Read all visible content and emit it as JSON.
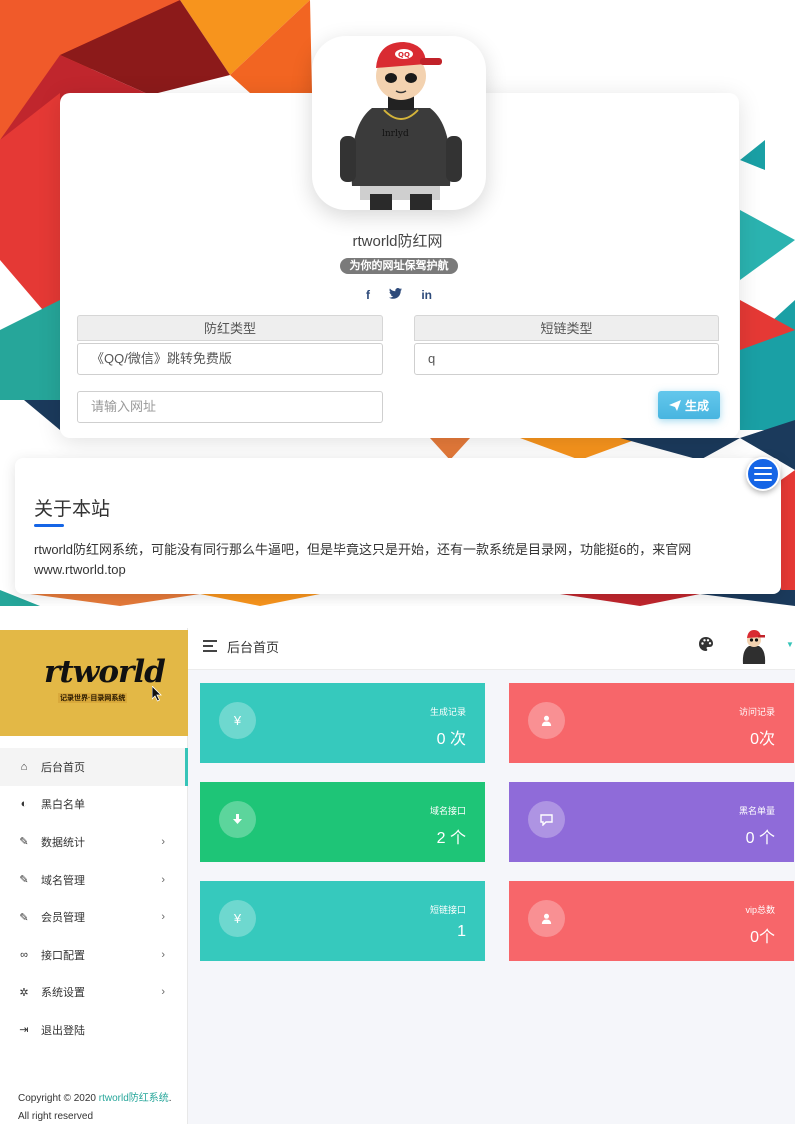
{
  "landing": {
    "site_name": "rtworld防红网",
    "slogan": "为你的网址保驾护航",
    "socials": [
      {
        "name": "facebook-icon",
        "glyph": "f"
      },
      {
        "name": "twitter-icon",
        "glyph": "🐦"
      },
      {
        "name": "linkedin-icon",
        "glyph": "in"
      }
    ],
    "form": {
      "type_label": "防红类型",
      "type_value": "《QQ/微信》跳转免费版",
      "short_label": "短链类型",
      "short_value": "q",
      "url_placeholder": "请输入网址",
      "generate_label": "生成"
    },
    "about": {
      "title": "关于本站",
      "text": "rtworld防红网系统，可能没有同行那么牛逼吧，但是毕竟这只是开始，还有一款系统是目录网，功能挺6的，来官网www.rtworld.top"
    }
  },
  "admin": {
    "logo_text": "rtworld",
    "logo_sub": "记录世界·目录网系统",
    "page_title": "后台首页",
    "nav": [
      {
        "label": "后台首页",
        "icon": "home-icon",
        "glyph": "⌂",
        "arrow": false,
        "active": true
      },
      {
        "label": "黑白名单",
        "icon": "shield-icon",
        "glyph": "◐",
        "arrow": false,
        "active": false
      },
      {
        "label": "数据统计",
        "icon": "pencil-icon",
        "glyph": "✎",
        "arrow": true,
        "active": false
      },
      {
        "label": "域名管理",
        "icon": "pencil-icon",
        "glyph": "✎",
        "arrow": true,
        "active": false
      },
      {
        "label": "会员管理",
        "icon": "pencil-icon",
        "glyph": "✎",
        "arrow": true,
        "active": false
      },
      {
        "label": "接口配置",
        "icon": "link-icon",
        "glyph": "∞",
        "arrow": true,
        "active": false
      },
      {
        "label": "系统设置",
        "icon": "gear-icon",
        "glyph": "✲",
        "arrow": true,
        "active": false
      },
      {
        "label": "退出登陆",
        "icon": "logout-icon",
        "glyph": "⇥",
        "arrow": false,
        "active": false
      }
    ],
    "nav_arrow": "›",
    "copyright": {
      "prefix": "Copyright © 2020 ",
      "brand": "rtworld防红系统",
      "suffix": ". All right reserved"
    },
    "stats": [
      {
        "label": "生成记录",
        "value": "0 次",
        "icon": "yen-icon",
        "glyph": "¥",
        "color": "#36c9bd"
      },
      {
        "label": "访问记录",
        "value": "0次",
        "icon": "user-icon",
        "glyph": "●",
        "color": "#f7666a"
      },
      {
        "label": "域名接口",
        "value": "2 个",
        "icon": "download-icon",
        "glyph": "⬇",
        "color": "#1ec577"
      },
      {
        "label": "黑名单量",
        "value": "0 个",
        "icon": "comment-icon",
        "glyph": "▭",
        "color": "#8f6bd9"
      },
      {
        "label": "短链接口",
        "value": "1",
        "icon": "yen-icon",
        "glyph": "¥",
        "color": "#36c9bd"
      },
      {
        "label": "vip总数",
        "value": "0个",
        "icon": "user-icon",
        "glyph": "●",
        "color": "#f7666a"
      }
    ]
  }
}
